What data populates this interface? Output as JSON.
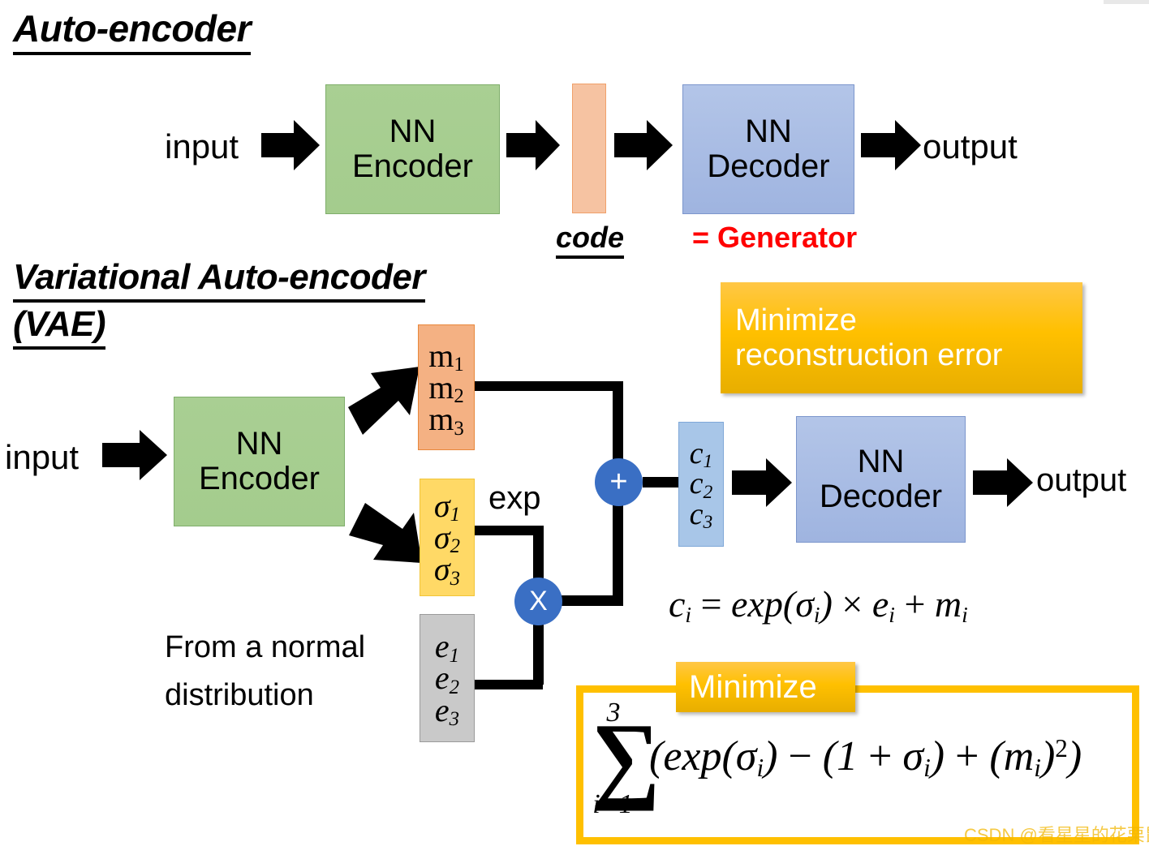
{
  "page": {
    "title": "Auto-encoder and Variational Auto-encoder (VAE) diagram",
    "watermark": "CSDN @看星星的花栗鼠"
  },
  "colors": {
    "encoder_green": "#a9cf93",
    "decoder_blue": "#b3c5e8",
    "code_orange": "#F6C3A2",
    "m_orange": "#F4B183",
    "sigma_yellow": "#FFD966",
    "e_gray": "#C9C9C9",
    "c_blue": "#A8C6E8",
    "operator_blue": "#3A6FC4",
    "callout_yellow": "#FFC000",
    "generator_red": "#FF0000",
    "arrow_black": "#000000"
  },
  "autoencoder": {
    "title": "Auto-encoder",
    "input_label": "input",
    "encoder_line1": "NN",
    "encoder_line2": "Encoder",
    "code_label": "code",
    "decoder_line1": "NN",
    "decoder_line2": "Decoder",
    "output_label": "output",
    "generator_label": "= Generator",
    "arrow_icons": [
      "arrow-right-icon",
      "arrow-right-icon",
      "arrow-right-icon",
      "arrow-right-icon"
    ]
  },
  "vae": {
    "title_line1": "Variational Auto-encoder",
    "title_line2": "(VAE)",
    "input_label": "input",
    "encoder_line1": "NN",
    "encoder_line2": "Encoder",
    "decoder_line1": "NN",
    "decoder_line2": "Decoder",
    "output_label": "output",
    "exp_label": "exp",
    "normal_note_line1": "From a normal",
    "normal_note_line2": "distribution",
    "m_vector": [
      "m",
      "m",
      "m"
    ],
    "m_subscripts": [
      "1",
      "2",
      "3"
    ],
    "sigma_vector": [
      "σ",
      "σ",
      "σ"
    ],
    "sigma_subscripts": [
      "1",
      "2",
      "3"
    ],
    "e_vector": [
      "e",
      "e",
      "e"
    ],
    "e_subscripts": [
      "1",
      "2",
      "3"
    ],
    "c_vector": [
      "c",
      "c",
      "c"
    ],
    "c_subscripts": [
      "1",
      "2",
      "3"
    ],
    "plus_operator": "+",
    "times_operator": "X"
  },
  "callouts": {
    "reconstruction": {
      "line1": "Minimize",
      "line2": "reconstruction error"
    },
    "minimize_label": "Minimize"
  },
  "formulas": {
    "code_formula": {
      "lhs_var": "c",
      "lhs_sub": "i",
      "eq": "=",
      "exp_word": "exp",
      "open": "(",
      "sigma": "σ",
      "sigma_sub": "i",
      "close": ")",
      "times": "×",
      "e_var": "e",
      "e_sub": "i",
      "plus": "+",
      "m_var": "m",
      "m_sub": "i",
      "plain": "c_i = exp(σ_i) × e_i + m_i"
    },
    "kl_formula": {
      "sum_glyph": "∑",
      "sum_upper": "3",
      "sum_lower": "i=1",
      "body": "(exp(σ_i) − (1 + σ_i) + (m_i)²)",
      "tokens": {
        "open_paren": "(",
        "exp_word": "exp",
        "sigma": "σ",
        "sub_i": "i",
        "minus": "−",
        "one": "1",
        "plus": "+",
        "m_var": "m",
        "square": "2",
        "close_paren": ")"
      }
    }
  }
}
